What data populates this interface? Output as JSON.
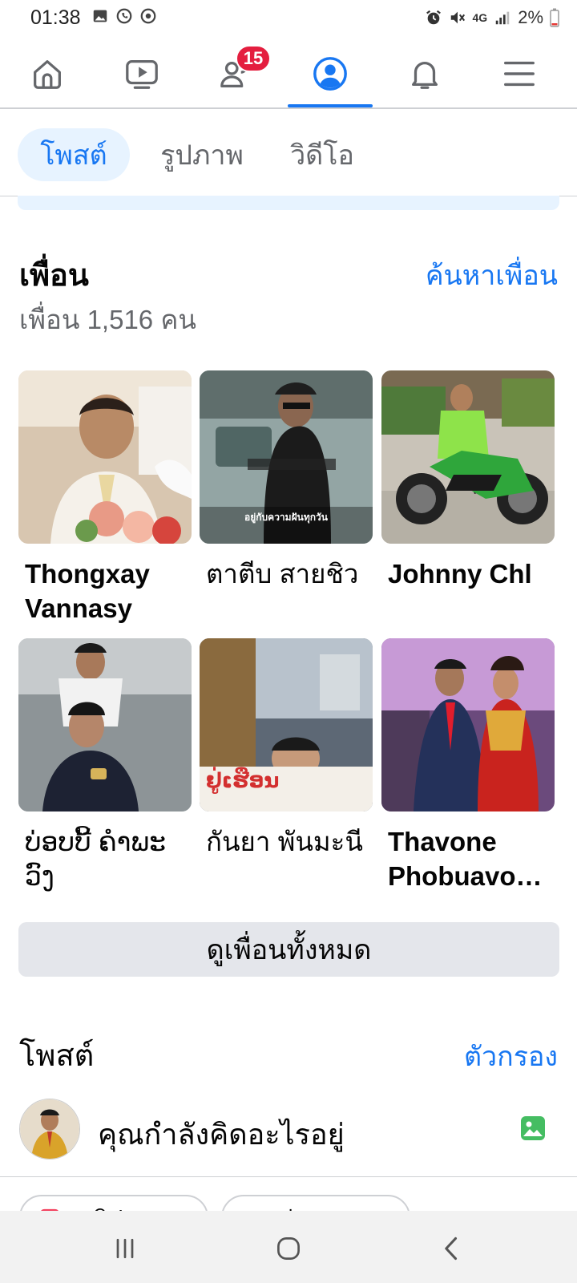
{
  "status_bar": {
    "time": "01:38",
    "battery": "2%",
    "network": "4G"
  },
  "nav": {
    "items": [
      "home-icon",
      "video-icon",
      "friends-icon",
      "profile-icon",
      "bell-icon",
      "menu-icon"
    ],
    "friends_badge": "15",
    "active": "profile"
  },
  "tabs": [
    {
      "label": "โพสต์",
      "active": true
    },
    {
      "label": "รูปภาพ",
      "active": false
    },
    {
      "label": "วิดีโอ",
      "active": false
    }
  ],
  "friends": {
    "title": "เพื่อน",
    "find_link": "ค้นหาเพื่อน",
    "count": "เพื่อน 1,516 คน",
    "list": [
      {
        "name": "Thongxay Vannasy",
        "overlay": ""
      },
      {
        "name": "ตาตีบ สายชิว",
        "overlay": "อยู่กับความฝันทุกวัน"
      },
      {
        "name": "Johnny Chl",
        "overlay": ""
      },
      {
        "name": "ບ່ອບບີ້ ຄຳພະວົງ",
        "overlay": ""
      },
      {
        "name": "กันยา พันมะนี",
        "overlay": "ຢູ່ເຮືອນ"
      },
      {
        "name": "Thavone Phobuavo…",
        "overlay": ""
      }
    ],
    "see_all": "ดูเพื่อนทั้งหมด"
  },
  "posts": {
    "title": "โพสต์",
    "filter_link": "ตัวกรอง",
    "composer_placeholder": "คุณกำลังคิดอะไรอยู่",
    "chips": [
      "คลิป",
      "ถ่ายทอด"
    ]
  },
  "colors": {
    "accent": "#1877f2",
    "badge": "#e41e3f",
    "photo_icon": "#45bd62"
  }
}
